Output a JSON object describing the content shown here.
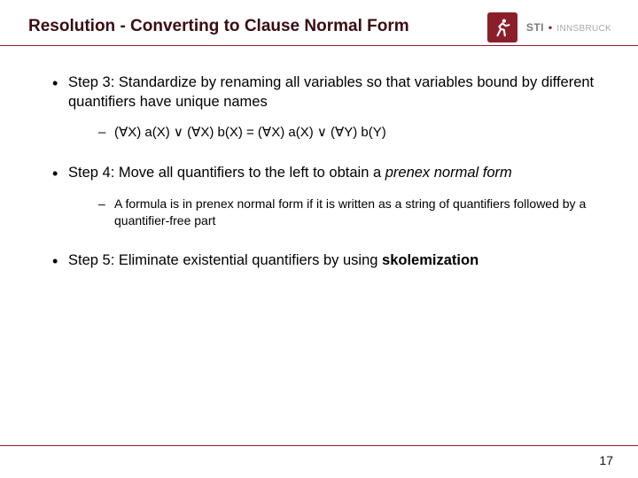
{
  "header": {
    "title": "Resolution - Converting to Clause Normal Form",
    "logo_org": "STI",
    "logo_sub": "INNSBRUCK"
  },
  "bullets": {
    "step3": "Step 3: Standardize by renaming all variables so that variables bound by different quantifiers have unique names",
    "step3_formula": "(∀X) a(X) ∨ (∀X) b(X) = (∀X) a(X) ∨ (∀Y) b(Y)",
    "step4": "Step 4: Move all quantifiers to the left to obtain a ",
    "step4_em": "prenex normal form",
    "step4_sub": "A formula is in prenex normal form if it is written as a string of quantifiers followed by a quantifier-free part",
    "step5": "Step 5: Eliminate existential quantifiers by using ",
    "step5_em": "skolemization"
  },
  "footer": {
    "page": "17"
  }
}
